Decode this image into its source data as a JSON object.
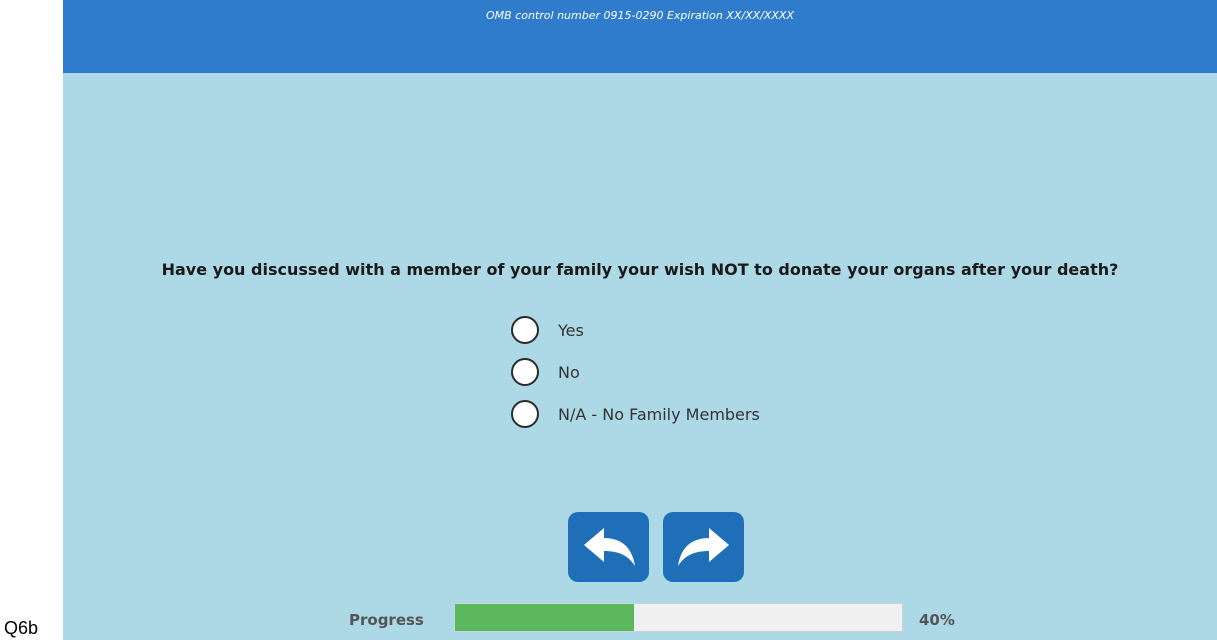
{
  "page_label": "Q6b",
  "header": {
    "omb_text": "OMB control number 0915-0290 Expiration XX/XX/XXXX",
    "background_color": "#2f7bcc"
  },
  "question": {
    "text": "Have you discussed with a member of your family your wish NOT to donate your organs after your death?"
  },
  "options": [
    {
      "label": "Yes",
      "selected": false
    },
    {
      "label": "No",
      "selected": false
    },
    {
      "label": "N/A - No Family Members",
      "selected": false
    }
  ],
  "navigation": {
    "back_icon": "curved-arrow-left-icon",
    "next_icon": "curved-arrow-right-icon",
    "button_color": "#1f6fb8"
  },
  "progress": {
    "label": "Progress",
    "value_percent": 40,
    "value_text": "40%",
    "fill_color": "#5cb85c"
  },
  "background_color": "#add8e6"
}
